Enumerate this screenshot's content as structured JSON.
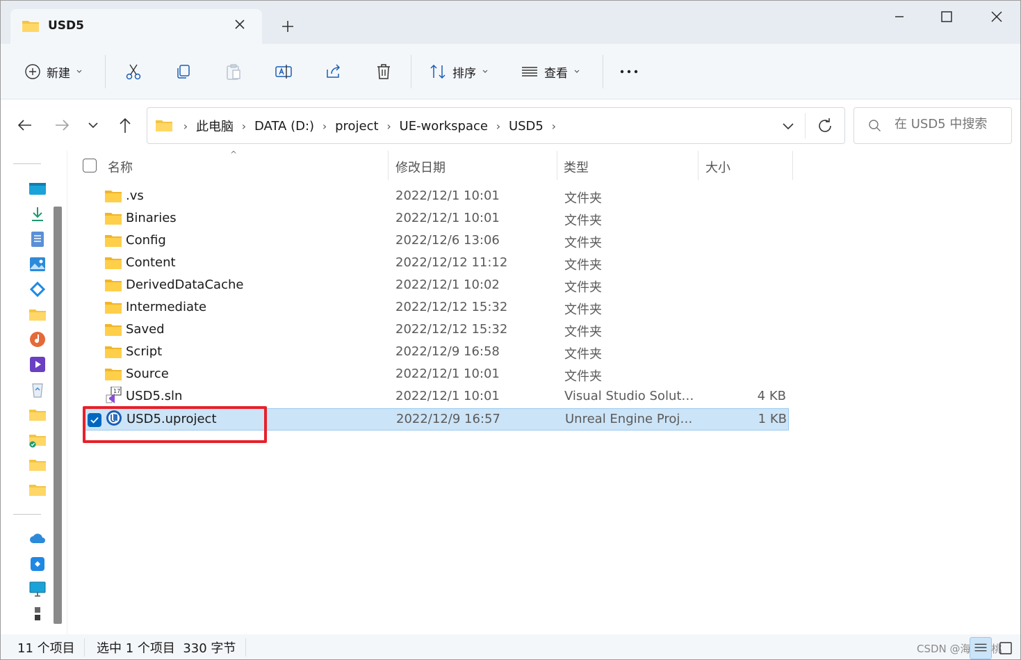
{
  "window": {
    "tab_title": "USD5"
  },
  "toolbar": {
    "new_label": "新建",
    "sort_label": "排序",
    "view_label": "查看"
  },
  "address": {
    "crumbs": [
      "此电脑",
      "DATA (D:)",
      "project",
      "UE-workspace",
      "USD5"
    ]
  },
  "search": {
    "placeholder": "在 USD5 中搜索"
  },
  "columns": {
    "name": "名称",
    "date": "修改日期",
    "type": "类型",
    "size": "大小"
  },
  "files": [
    {
      "name": ".vs",
      "date": "2022/12/1 10:01",
      "type": "文件夹",
      "size": "",
      "icon": "folder-icon"
    },
    {
      "name": "Binaries",
      "date": "2022/12/1 10:01",
      "type": "文件夹",
      "size": "",
      "icon": "folder-icon"
    },
    {
      "name": "Config",
      "date": "2022/12/6 13:06",
      "type": "文件夹",
      "size": "",
      "icon": "folder-icon"
    },
    {
      "name": "Content",
      "date": "2022/12/12 11:12",
      "type": "文件夹",
      "size": "",
      "icon": "folder-icon"
    },
    {
      "name": "DerivedDataCache",
      "date": "2022/12/1 10:02",
      "type": "文件夹",
      "size": "",
      "icon": "folder-icon"
    },
    {
      "name": "Intermediate",
      "date": "2022/12/12 15:32",
      "type": "文件夹",
      "size": "",
      "icon": "folder-icon"
    },
    {
      "name": "Saved",
      "date": "2022/12/12 15:32",
      "type": "文件夹",
      "size": "",
      "icon": "folder-icon"
    },
    {
      "name": "Script",
      "date": "2022/12/9 16:58",
      "type": "文件夹",
      "size": "",
      "icon": "folder-icon"
    },
    {
      "name": "Source",
      "date": "2022/12/1 10:01",
      "type": "文件夹",
      "size": "",
      "icon": "folder-icon"
    },
    {
      "name": "USD5.sln",
      "date": "2022/12/1 10:01",
      "type": "Visual Studio Soluti...",
      "size": "4 KB",
      "icon": "visual-studio-icon"
    },
    {
      "name": "USD5.uproject",
      "date": "2022/12/9 16:57",
      "type": "Unreal Engine Proje...",
      "size": "1 KB",
      "icon": "unreal-engine-icon",
      "selected": true
    }
  ],
  "status": {
    "count": "11 个项目",
    "selection": "选中 1 个项目  330 字节"
  },
  "watermark": "CSDN @海莲胡桃",
  "colors": {
    "accent": "#0067c0",
    "selection_bg": "#cce4f7",
    "highlight_box": "#e8202a",
    "folder": "#f4c542"
  }
}
